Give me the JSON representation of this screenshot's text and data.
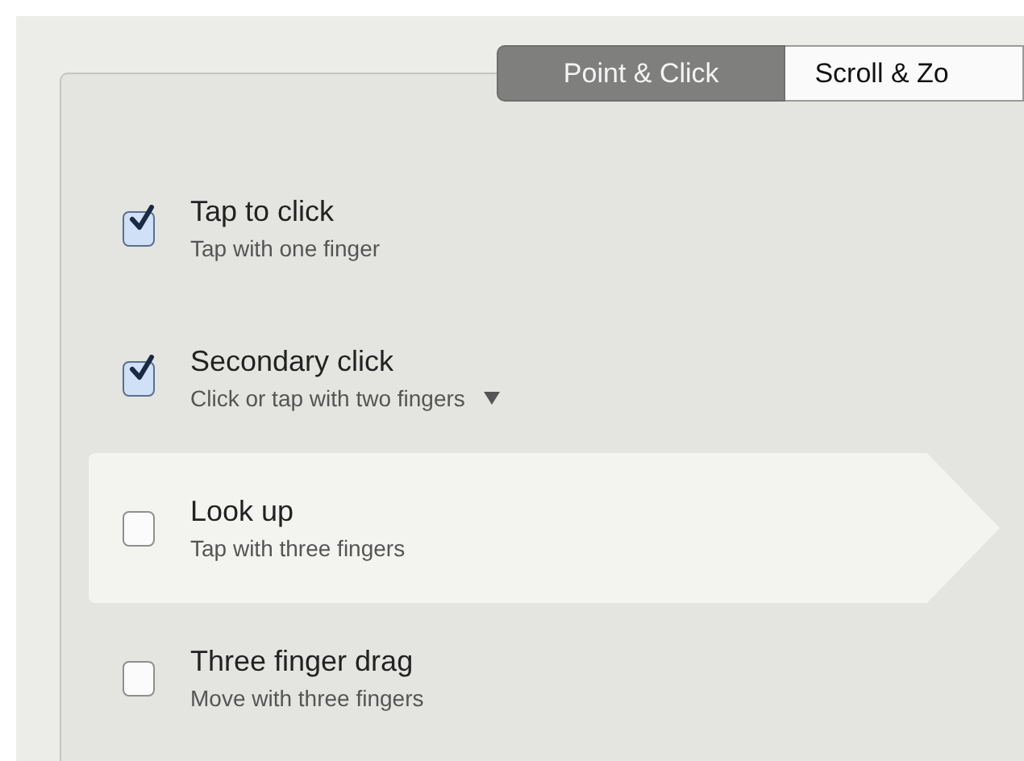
{
  "tabs": [
    {
      "label": "Point & Click",
      "selected": true
    },
    {
      "label": "Scroll & Zo",
      "selected": false
    }
  ],
  "options": [
    {
      "title": "Tap to click",
      "subtitle": "Tap with one finger",
      "checked": true,
      "selected": false,
      "has_menu": false
    },
    {
      "title": "Secondary click",
      "subtitle": "Click or tap with two fingers",
      "checked": true,
      "selected": false,
      "has_menu": true
    },
    {
      "title": "Look up",
      "subtitle": "Tap with three fingers",
      "checked": false,
      "selected": true,
      "has_menu": false
    },
    {
      "title": "Three finger drag",
      "subtitle": "Move with three fingers",
      "checked": false,
      "selected": false,
      "has_menu": false
    }
  ]
}
